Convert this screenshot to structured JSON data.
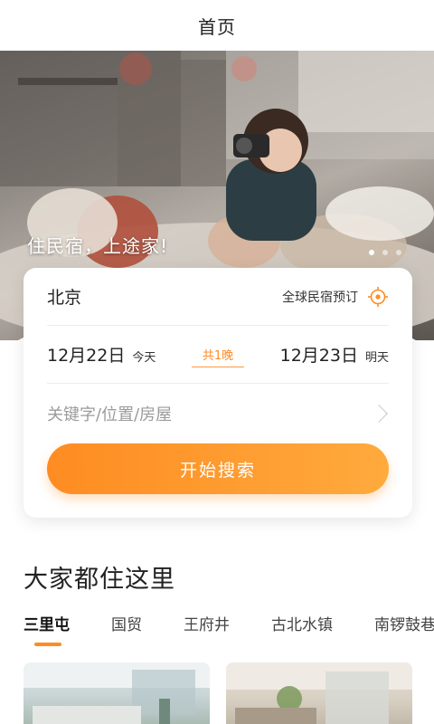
{
  "header": {
    "title": "首页"
  },
  "banner": {
    "slogan": "住民宿，上途家!",
    "slides": [
      true,
      false,
      false
    ]
  },
  "search": {
    "city": "北京",
    "global_label": "全球民宿预订",
    "checkin_date": "12月22日",
    "checkin_note": "今天",
    "nights": "共1晚",
    "checkout_date": "12月23日",
    "checkout_note": "明天",
    "keyword_placeholder": "关键字/位置/房屋",
    "button_label": "开始搜索"
  },
  "popular": {
    "title": "大家都住这里",
    "tabs": [
      {
        "label": "三里屯",
        "active": true
      },
      {
        "label": "国贸"
      },
      {
        "label": "王府井"
      },
      {
        "label": "古北水镇"
      },
      {
        "label": "南锣鼓巷"
      }
    ]
  },
  "colors": {
    "accent": "#ff8c22",
    "accent_light": "#ffaa3d"
  }
}
